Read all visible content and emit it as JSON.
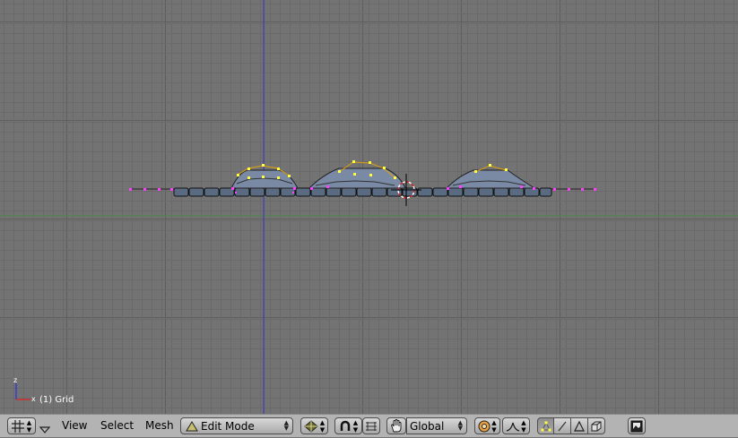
{
  "viewport": {
    "object_label": "(1) Grid",
    "axis_z_label": "z",
    "axis_x_label": "x",
    "colors": {
      "background": "#737373",
      "vertex_selected": "#ffff40",
      "vertex_unselected": "#ff40ff",
      "cursor": "#e02020",
      "x_axis_line": "#4a8a4a",
      "z_axis_line": "#3a3acc"
    }
  },
  "header": {
    "window_type_icon": "grid-icon",
    "menus": [
      "View",
      "Select",
      "Mesh"
    ],
    "mode": {
      "label": "Edit Mode",
      "icon": "mesh-triangle-icon"
    },
    "draw_type_icon": "shaded-sphere-icon",
    "pivot_icon": "magnet-icon",
    "transform_manipulator_icon": "hand-icon",
    "orientation": "Global",
    "proportional_icon": "proportional-edit-icon",
    "falloff_icon": "falloff-curve-icon",
    "select_modes": [
      "vertex-select-icon",
      "edge-select-icon",
      "face-select-icon"
    ],
    "occlude_icon": "occlude-background-icon",
    "render_icon": "render-image-icon"
  }
}
